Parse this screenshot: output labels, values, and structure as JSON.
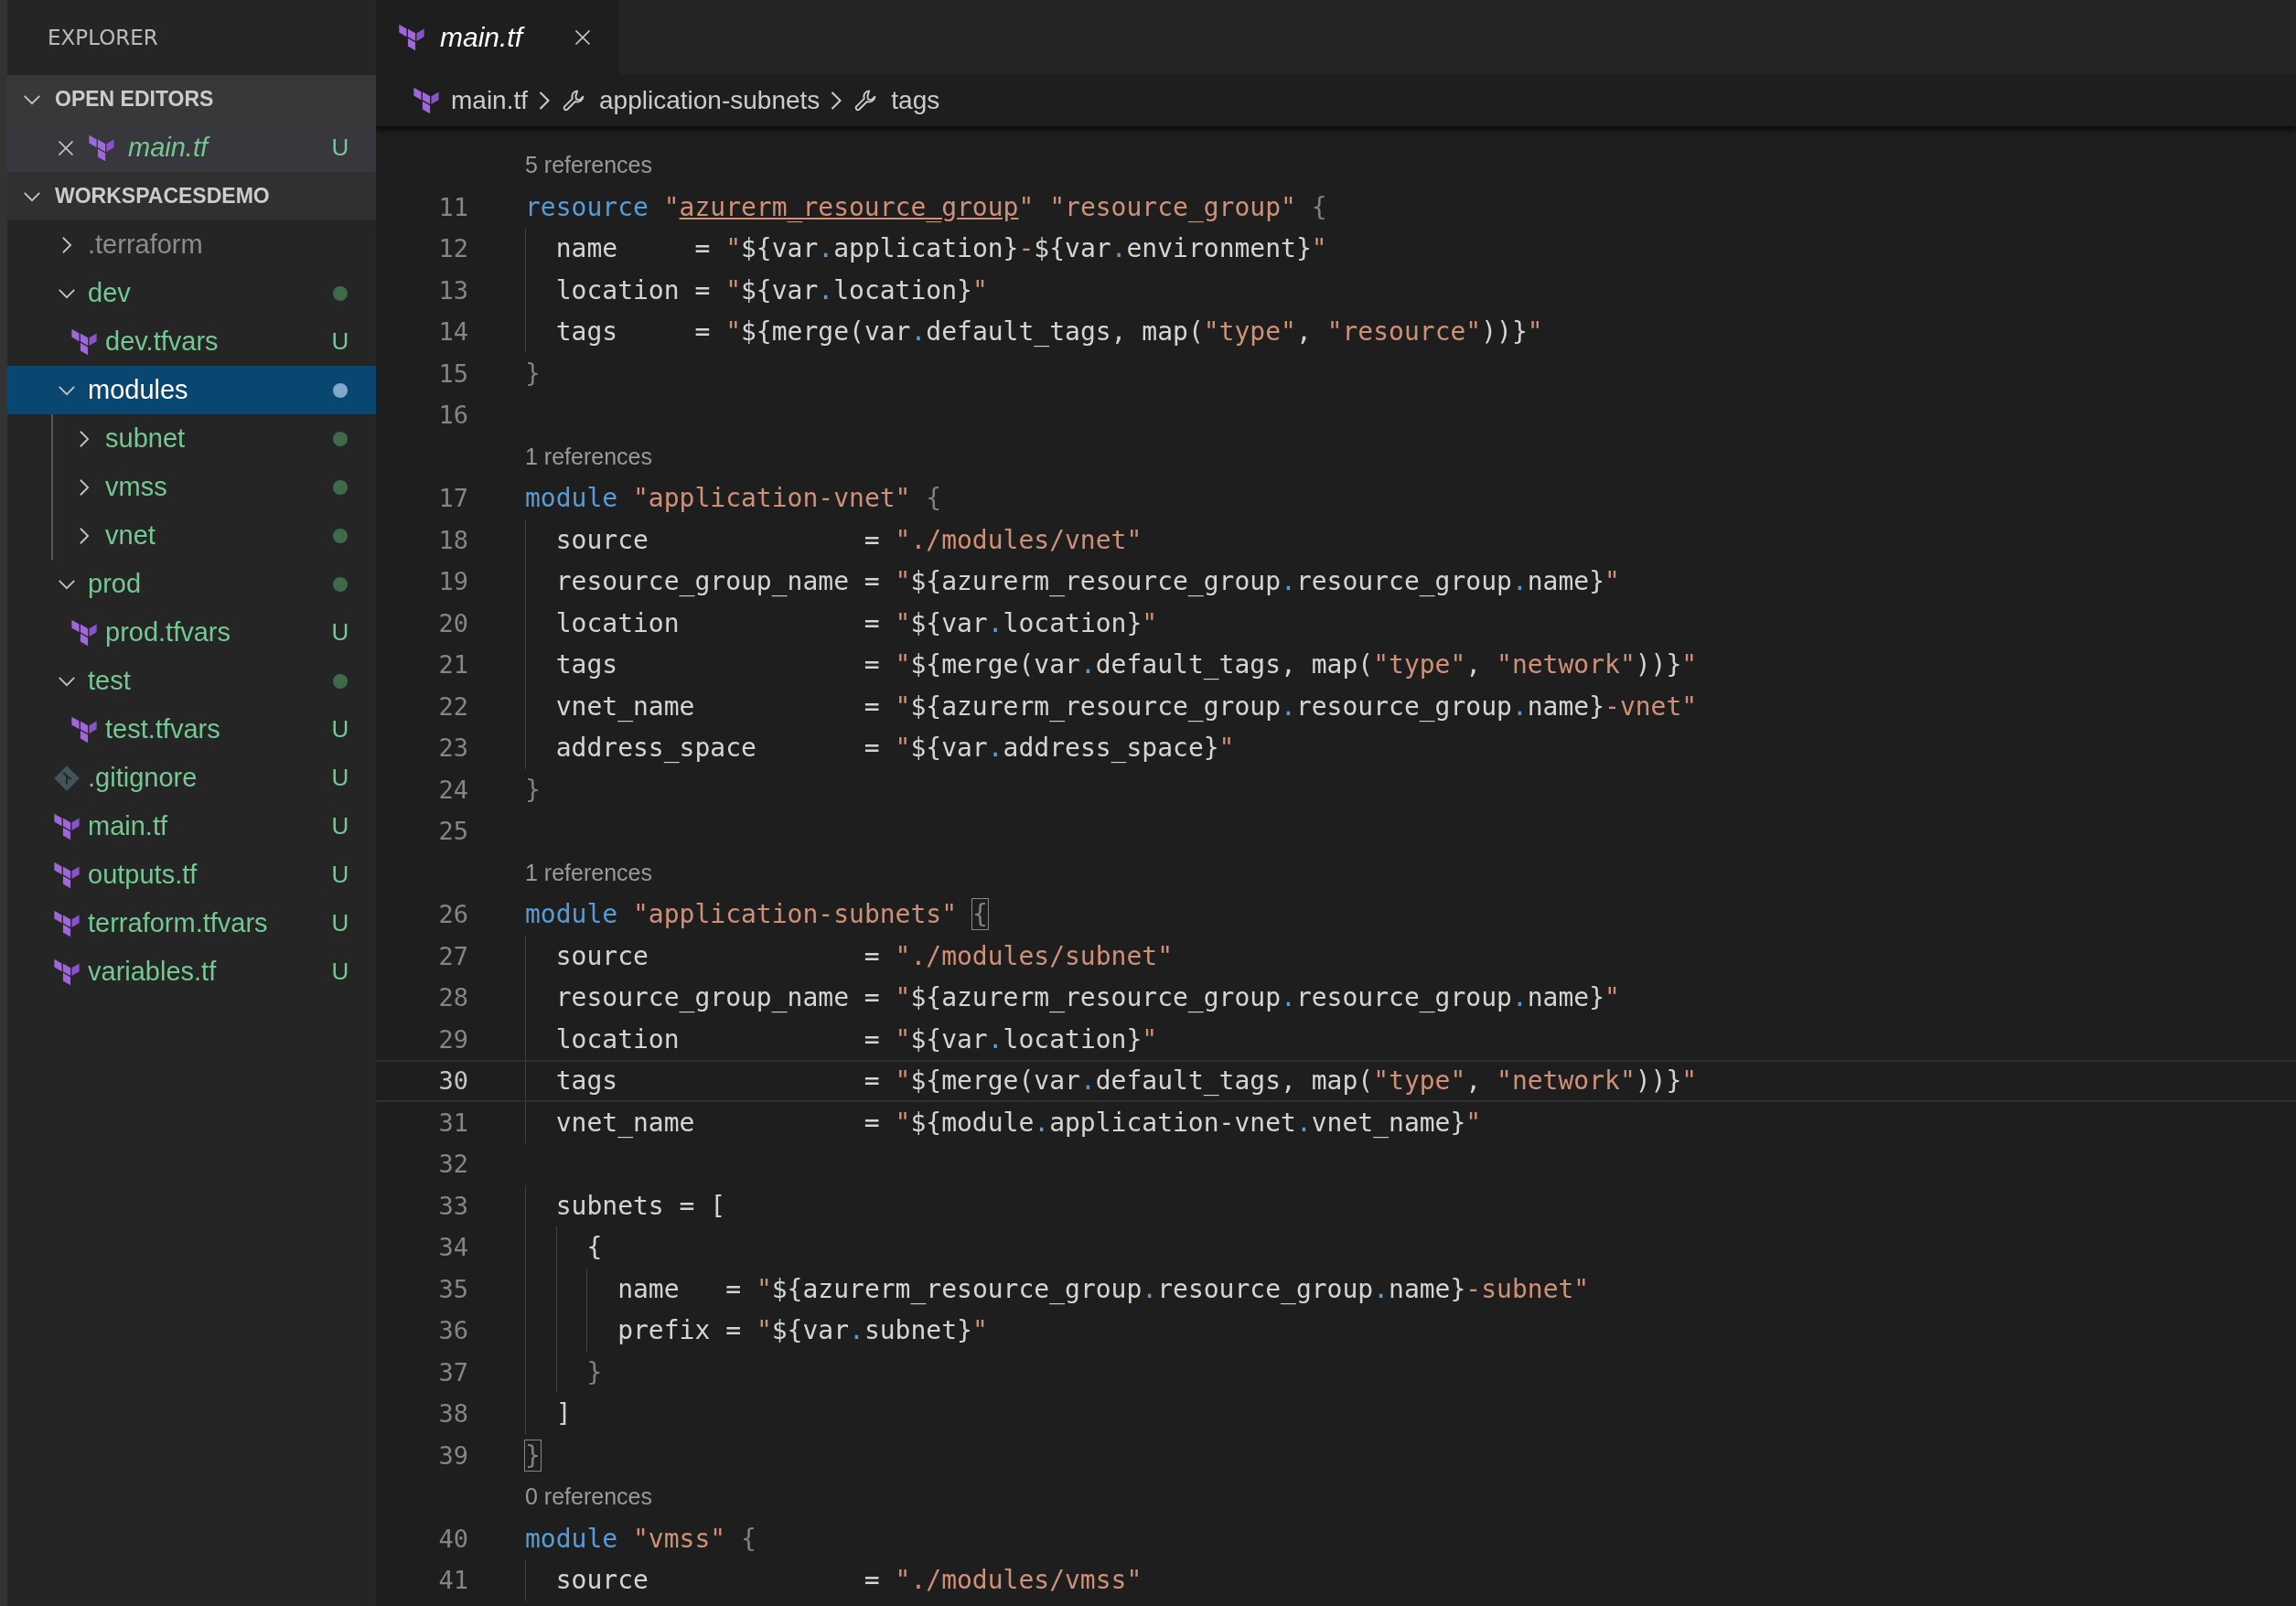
{
  "sidebar": {
    "title": "EXPLORER",
    "open_editors": {
      "title": "OPEN EDITORS",
      "expanded": true,
      "items": [
        {
          "kind": "terraform-file",
          "label": "main.tf",
          "italic": true,
          "badge": "U"
        }
      ]
    },
    "workspace": {
      "title": "WORKSPACESDEMO",
      "expanded": true,
      "items": [
        {
          "kind": "folder",
          "label": ".terraform",
          "ignored": true,
          "expanded": false,
          "selected": false,
          "dot": false
        },
        {
          "kind": "folder",
          "label": "dev",
          "ignored": false,
          "expanded": true,
          "selected": false,
          "dot": true,
          "children": [
            {
              "kind": "terraform-file",
              "label": "dev.tfvars",
              "ignored": false,
              "selected": false,
              "badge": "U"
            }
          ]
        },
        {
          "kind": "folder",
          "label": "modules",
          "ignored": false,
          "expanded": true,
          "selected": true,
          "dot": true,
          "children": [
            {
              "kind": "folder",
              "label": "subnet",
              "ignored": false,
              "expanded": false,
              "selected": false,
              "dot": true
            },
            {
              "kind": "folder",
              "label": "vmss",
              "ignored": false,
              "expanded": false,
              "selected": false,
              "dot": true
            },
            {
              "kind": "folder",
              "label": "vnet",
              "ignored": false,
              "expanded": false,
              "selected": false,
              "dot": true
            }
          ]
        },
        {
          "kind": "folder",
          "label": "prod",
          "ignored": false,
          "expanded": true,
          "selected": false,
          "dot": true,
          "children": [
            {
              "kind": "terraform-file",
              "label": "prod.tfvars",
              "ignored": false,
              "selected": false,
              "badge": "U"
            }
          ]
        },
        {
          "kind": "folder",
          "label": "test",
          "ignored": false,
          "expanded": true,
          "selected": false,
          "dot": true,
          "children": [
            {
              "kind": "terraform-file",
              "label": "test.tfvars",
              "ignored": false,
              "selected": false,
              "badge": "U"
            }
          ]
        },
        {
          "kind": "git-file",
          "label": ".gitignore",
          "ignored": false,
          "selected": false,
          "badge": "U"
        },
        {
          "kind": "terraform-file",
          "label": "main.tf",
          "ignored": false,
          "selected": false,
          "badge": "U"
        },
        {
          "kind": "terraform-file",
          "label": "outputs.tf",
          "ignored": false,
          "selected": false,
          "badge": "U"
        },
        {
          "kind": "terraform-file",
          "label": "terraform.tfvars",
          "ignored": false,
          "selected": false,
          "badge": "U"
        },
        {
          "kind": "terraform-file",
          "label": "variables.tf",
          "ignored": false,
          "selected": false,
          "badge": "U"
        }
      ]
    }
  },
  "tabs": [
    {
      "kind": "terraform-file",
      "label": "main.tf",
      "italic": true,
      "selected": true
    }
  ],
  "breadcrumb": [
    {
      "kind": "file",
      "label": "main.tf"
    },
    {
      "kind": "symbol",
      "label": "application-subnets"
    },
    {
      "kind": "symbol",
      "label": "tags"
    }
  ],
  "editor": {
    "rows": [
      {
        "kind": "lens",
        "text": "5 references"
      },
      {
        "kind": "code",
        "number": "11",
        "current": false,
        "tokens": [
          {
            "kind": "kw",
            "text": "resource"
          },
          {
            "kind": "str",
            "text": " \""
          },
          {
            "kind": "link",
            "text": "azurerm_resource_group"
          },
          {
            "kind": "str",
            "text": "\" \"resource_group\" "
          },
          {
            "kind": "dim",
            "text": "{"
          }
        ]
      },
      {
        "kind": "code",
        "number": "12",
        "current": false,
        "tokens": [
          {
            "kind": "txt",
            "text": "  name     = "
          },
          {
            "kind": "str",
            "text": "\""
          },
          {
            "kind": "txt",
            "text": "${var"
          },
          {
            "kind": "dot",
            "text": "."
          },
          {
            "kind": "txt",
            "text": "application}"
          },
          {
            "kind": "str",
            "text": "-"
          },
          {
            "kind": "txt",
            "text": "${var"
          },
          {
            "kind": "dot",
            "text": "."
          },
          {
            "kind": "txt",
            "text": "environment}"
          },
          {
            "kind": "str",
            "text": "\""
          }
        ]
      },
      {
        "kind": "code",
        "number": "13",
        "current": false,
        "tokens": [
          {
            "kind": "txt",
            "text": "  location = "
          },
          {
            "kind": "str",
            "text": "\""
          },
          {
            "kind": "txt",
            "text": "${var"
          },
          {
            "kind": "dot",
            "text": "."
          },
          {
            "kind": "txt",
            "text": "location}"
          },
          {
            "kind": "str",
            "text": "\""
          }
        ]
      },
      {
        "kind": "code",
        "number": "14",
        "current": false,
        "tokens": [
          {
            "kind": "txt",
            "text": "  tags     = "
          },
          {
            "kind": "str",
            "text": "\""
          },
          {
            "kind": "txt",
            "text": "${merge(var"
          },
          {
            "kind": "dot",
            "text": "."
          },
          {
            "kind": "txt",
            "text": "default_tags, map("
          },
          {
            "kind": "str",
            "text": "\"type\""
          },
          {
            "kind": "txt",
            "text": ", "
          },
          {
            "kind": "str",
            "text": "\"resource\""
          },
          {
            "kind": "txt",
            "text": "))}"
          },
          {
            "kind": "str",
            "text": "\""
          }
        ]
      },
      {
        "kind": "code",
        "number": "15",
        "current": false,
        "tokens": [
          {
            "kind": "dim",
            "text": "}"
          }
        ]
      },
      {
        "kind": "code",
        "number": "16",
        "current": false
      },
      {
        "kind": "lens",
        "text": "1 references"
      },
      {
        "kind": "code",
        "number": "17",
        "current": false,
        "tokens": [
          {
            "kind": "kw",
            "text": "module"
          },
          {
            "kind": "str",
            "text": " \"application-vnet\" "
          },
          {
            "kind": "dim",
            "text": "{"
          }
        ]
      },
      {
        "kind": "code",
        "number": "18",
        "current": false,
        "tokens": [
          {
            "kind": "txt",
            "text": "  source              = "
          },
          {
            "kind": "str",
            "text": "\"./modules/vnet\""
          }
        ]
      },
      {
        "kind": "code",
        "number": "19",
        "current": false,
        "tokens": [
          {
            "kind": "txt",
            "text": "  resource_group_name = "
          },
          {
            "kind": "str",
            "text": "\""
          },
          {
            "kind": "txt",
            "text": "${azurerm_resource_group"
          },
          {
            "kind": "dot",
            "text": "."
          },
          {
            "kind": "txt",
            "text": "resource_group"
          },
          {
            "kind": "dot",
            "text": "."
          },
          {
            "kind": "txt",
            "text": "name}"
          },
          {
            "kind": "str",
            "text": "\""
          }
        ]
      },
      {
        "kind": "code",
        "number": "20",
        "current": false,
        "tokens": [
          {
            "kind": "txt",
            "text": "  location            = "
          },
          {
            "kind": "str",
            "text": "\""
          },
          {
            "kind": "txt",
            "text": "${var"
          },
          {
            "kind": "dot",
            "text": "."
          },
          {
            "kind": "txt",
            "text": "location}"
          },
          {
            "kind": "str",
            "text": "\""
          }
        ]
      },
      {
        "kind": "code",
        "number": "21",
        "current": false,
        "tokens": [
          {
            "kind": "txt",
            "text": "  tags                = "
          },
          {
            "kind": "str",
            "text": "\""
          },
          {
            "kind": "txt",
            "text": "${merge(var"
          },
          {
            "kind": "dot",
            "text": "."
          },
          {
            "kind": "txt",
            "text": "default_tags, map("
          },
          {
            "kind": "str",
            "text": "\"type\""
          },
          {
            "kind": "txt",
            "text": ", "
          },
          {
            "kind": "str",
            "text": "\"network\""
          },
          {
            "kind": "txt",
            "text": "))}"
          },
          {
            "kind": "str",
            "text": "\""
          }
        ]
      },
      {
        "kind": "code",
        "number": "22",
        "current": false,
        "tokens": [
          {
            "kind": "txt",
            "text": "  vnet_name           = "
          },
          {
            "kind": "str",
            "text": "\""
          },
          {
            "kind": "txt",
            "text": "${azurerm_resource_group"
          },
          {
            "kind": "dot",
            "text": "."
          },
          {
            "kind": "txt",
            "text": "resource_group"
          },
          {
            "kind": "dot",
            "text": "."
          },
          {
            "kind": "txt",
            "text": "name}"
          },
          {
            "kind": "str",
            "text": "-vnet\""
          }
        ]
      },
      {
        "kind": "code",
        "number": "23",
        "current": false,
        "tokens": [
          {
            "kind": "txt",
            "text": "  address_space       = "
          },
          {
            "kind": "str",
            "text": "\""
          },
          {
            "kind": "txt",
            "text": "${var"
          },
          {
            "kind": "dot",
            "text": "."
          },
          {
            "kind": "txt",
            "text": "address_space}"
          },
          {
            "kind": "str",
            "text": "\""
          }
        ]
      },
      {
        "kind": "code",
        "number": "24",
        "current": false,
        "tokens": [
          {
            "kind": "dim",
            "text": "}"
          }
        ]
      },
      {
        "kind": "code",
        "number": "25",
        "current": false
      },
      {
        "kind": "lens",
        "text": "1 references"
      },
      {
        "kind": "code",
        "number": "26",
        "current": false,
        "tokens": [
          {
            "kind": "kw",
            "text": "module"
          },
          {
            "kind": "str",
            "text": " \"application-subnets\" "
          },
          {
            "kind": "match",
            "text": "{"
          }
        ]
      },
      {
        "kind": "code",
        "number": "27",
        "current": false,
        "tokens": [
          {
            "kind": "txt",
            "text": "  source              = "
          },
          {
            "kind": "str",
            "text": "\"./modules/subnet\""
          }
        ]
      },
      {
        "kind": "code",
        "number": "28",
        "current": false,
        "tokens": [
          {
            "kind": "txt",
            "text": "  resource_group_name = "
          },
          {
            "kind": "str",
            "text": "\""
          },
          {
            "kind": "txt",
            "text": "${azurerm_resource_group"
          },
          {
            "kind": "dot",
            "text": "."
          },
          {
            "kind": "txt",
            "text": "resource_group"
          },
          {
            "kind": "dot",
            "text": "."
          },
          {
            "kind": "txt",
            "text": "name}"
          },
          {
            "kind": "str",
            "text": "\""
          }
        ]
      },
      {
        "kind": "code",
        "number": "29",
        "current": false,
        "tokens": [
          {
            "kind": "txt",
            "text": "  location            = "
          },
          {
            "kind": "str",
            "text": "\""
          },
          {
            "kind": "txt",
            "text": "${var"
          },
          {
            "kind": "dot",
            "text": "."
          },
          {
            "kind": "txt",
            "text": "location}"
          },
          {
            "kind": "str",
            "text": "\""
          }
        ]
      },
      {
        "kind": "code",
        "number": "30",
        "current": true,
        "tokens": [
          {
            "kind": "txt",
            "text": "  tags                = "
          },
          {
            "kind": "str",
            "text": "\""
          },
          {
            "kind": "txt",
            "text": "${merge(var"
          },
          {
            "kind": "dot",
            "text": "."
          },
          {
            "kind": "txt",
            "text": "default_tags, map("
          },
          {
            "kind": "str",
            "text": "\"type\""
          },
          {
            "kind": "txt",
            "text": ", "
          },
          {
            "kind": "str",
            "text": "\"network\""
          },
          {
            "kind": "txt",
            "text": "))}"
          },
          {
            "kind": "str",
            "text": "\""
          }
        ]
      },
      {
        "kind": "code",
        "number": "31",
        "current": false,
        "tokens": [
          {
            "kind": "txt",
            "text": "  vnet_name           = "
          },
          {
            "kind": "str",
            "text": "\""
          },
          {
            "kind": "txt",
            "text": "${module"
          },
          {
            "kind": "dot",
            "text": "."
          },
          {
            "kind": "txt",
            "text": "application-vnet"
          },
          {
            "kind": "dot",
            "text": "."
          },
          {
            "kind": "txt",
            "text": "vnet_name}"
          },
          {
            "kind": "str",
            "text": "\""
          }
        ]
      },
      {
        "kind": "code",
        "number": "32",
        "current": false
      },
      {
        "kind": "code",
        "number": "33",
        "current": false,
        "tokens": [
          {
            "kind": "txt",
            "text": "  subnets = ["
          }
        ]
      },
      {
        "kind": "code",
        "number": "34",
        "current": false,
        "tokens": [
          {
            "kind": "txt",
            "text": "    {"
          }
        ]
      },
      {
        "kind": "code",
        "number": "35",
        "current": false,
        "tokens": [
          {
            "kind": "txt",
            "text": "      name   = "
          },
          {
            "kind": "str",
            "text": "\""
          },
          {
            "kind": "txt",
            "text": "${azurerm_resource_group"
          },
          {
            "kind": "dot",
            "text": "."
          },
          {
            "kind": "txt",
            "text": "resource_group"
          },
          {
            "kind": "dot",
            "text": "."
          },
          {
            "kind": "txt",
            "text": "name}"
          },
          {
            "kind": "str",
            "text": "-subnet\""
          }
        ]
      },
      {
        "kind": "code",
        "number": "36",
        "current": false,
        "tokens": [
          {
            "kind": "txt",
            "text": "      prefix = "
          },
          {
            "kind": "str",
            "text": "\""
          },
          {
            "kind": "txt",
            "text": "${var"
          },
          {
            "kind": "dot",
            "text": "."
          },
          {
            "kind": "txt",
            "text": "subnet}"
          },
          {
            "kind": "str",
            "text": "\""
          }
        ]
      },
      {
        "kind": "code",
        "number": "37",
        "current": false,
        "tokens": [
          {
            "kind": "dim",
            "text": "    }"
          }
        ]
      },
      {
        "kind": "code",
        "number": "38",
        "current": false,
        "tokens": [
          {
            "kind": "txt",
            "text": "  ]"
          }
        ]
      },
      {
        "kind": "code",
        "number": "39",
        "current": false,
        "tokens": [
          {
            "kind": "match",
            "text": "}"
          }
        ]
      },
      {
        "kind": "lens",
        "text": "0 references"
      },
      {
        "kind": "code",
        "number": "40",
        "current": false,
        "tokens": [
          {
            "kind": "kw",
            "text": "module"
          },
          {
            "kind": "str",
            "text": " \"vmss\" "
          },
          {
            "kind": "dim",
            "text": "{"
          }
        ]
      },
      {
        "kind": "code",
        "number": "41",
        "current": false,
        "tokens": [
          {
            "kind": "txt",
            "text": "  source              = "
          },
          {
            "kind": "str",
            "text": "\"./modules/vmss\""
          }
        ]
      }
    ]
  }
}
